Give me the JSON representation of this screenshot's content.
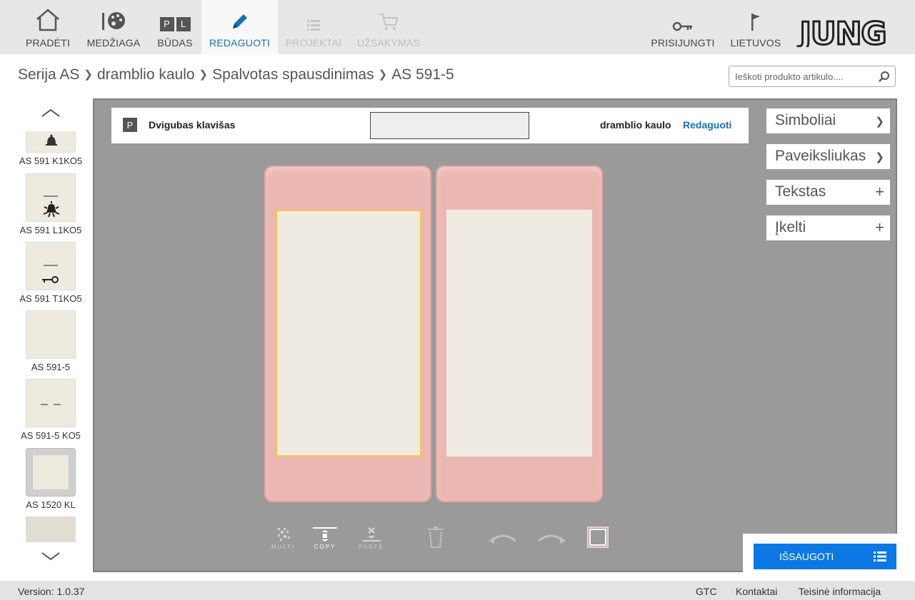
{
  "nav": {
    "items": [
      {
        "label": "PRADĖTI",
        "icon": "home-icon",
        "state": "normal"
      },
      {
        "label": "MEDŽIAGA",
        "icon": "palette-icon",
        "state": "normal"
      },
      {
        "label": "BŪDAS",
        "icon": "pl-icon",
        "icon_text_p": "P",
        "icon_text_l": "L",
        "state": "normal"
      },
      {
        "label": "REDAGUOTI",
        "icon": "pencil-icon",
        "state": "active"
      },
      {
        "label": "PROJEKTAI",
        "icon": "list-icon",
        "state": "disabled"
      },
      {
        "label": "UŽSAKYMAS",
        "icon": "cart-icon",
        "state": "disabled"
      }
    ],
    "right_items": [
      {
        "label": "PRISIJUNGTI",
        "icon": "key-icon"
      },
      {
        "label": "LIETUVOS",
        "icon": "flag-icon"
      }
    ],
    "logo_text": "JUNG",
    "active_color": "#1a6fb5"
  },
  "breadcrumb": {
    "items": [
      "Serija AS",
      "dramblio kaulo",
      "Spalvotas spausdinimas",
      "AS 591-5"
    ],
    "separator": "❯"
  },
  "search": {
    "placeholder": "Ieškoti produkto artikulo...."
  },
  "products": [
    {
      "name": "AS 591 K1KO5",
      "symbol": "bell"
    },
    {
      "name": "AS 591 L1KO5",
      "symbol": "lamp"
    },
    {
      "name": "AS 591 T1KO5",
      "symbol": "key"
    },
    {
      "name": "AS 591-5",
      "symbol": "none"
    },
    {
      "name": "AS 591-5 KO5",
      "symbol": "dashes"
    },
    {
      "name": "AS 1520 KL",
      "symbol": "frame"
    }
  ],
  "editor": {
    "badge": "P",
    "product_name": "Dvigubas klavišas",
    "color_name": "dramblio kaulo",
    "edit_link": "Redaguoti",
    "switch_color": "#ebb7b2",
    "field_color": "#efebe2",
    "selection_color": "#f2c94c"
  },
  "right_panels": [
    {
      "label": "Simboliai",
      "symbol": "❯"
    },
    {
      "label": "Paveiksliukas",
      "symbol": "❯"
    },
    {
      "label": "Tekstas",
      "symbol": "+"
    },
    {
      "label": "Įkelti",
      "symbol": "+"
    }
  ],
  "tools": {
    "multi": "MULTI",
    "copy": "COPY",
    "paste": "PASTE"
  },
  "save": {
    "label": "IŠSAUGOTI",
    "color": "#0b78e3"
  },
  "footer": {
    "version": "Version: 1.0.37",
    "links": [
      "GTC",
      "Kontaktai",
      "Teisinė informacija"
    ]
  }
}
